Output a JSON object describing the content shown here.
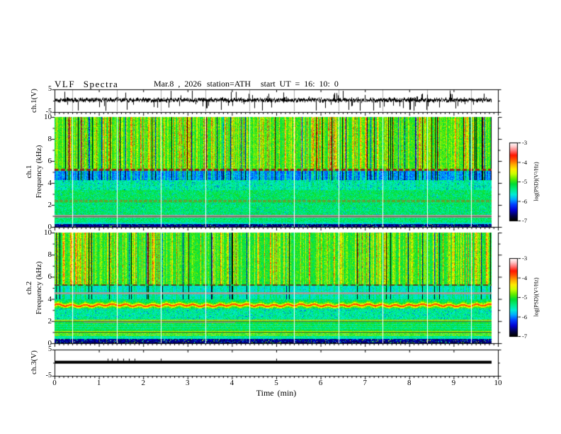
{
  "header": {
    "title": "VLF Spectra",
    "date": "Mar.8 , 2026",
    "station": "station=ATH",
    "start_ut": "start UT = 16: 10: 0"
  },
  "figure": {
    "xlabel": "Time (min)",
    "x_ticks": [
      0,
      1,
      2,
      3,
      4,
      5,
      6,
      7,
      8,
      9,
      10
    ],
    "x_range_min": [
      0,
      10
    ],
    "panels": [
      {
        "id": "ch1-waveform",
        "ylabel": "ch.1(V)",
        "y_ticks": [
          5,
          -5
        ],
        "y_range": [
          -5,
          5
        ],
        "type": "line"
      },
      {
        "id": "ch1-spectrogram",
        "channel": "ch.1",
        "ylabel": "Frequency (kHz)",
        "y_ticks": [
          10,
          8,
          6,
          4,
          2,
          0
        ],
        "y_range": [
          0,
          10
        ],
        "type": "heatmap"
      },
      {
        "id": "ch2-spectrogram",
        "channel": "ch.2",
        "ylabel": "Frequency (kHz)",
        "y_ticks": [
          10,
          8,
          6,
          4,
          2,
          0
        ],
        "y_range": [
          0,
          10
        ],
        "type": "heatmap"
      },
      {
        "id": "ch3-waveform",
        "ylabel": "ch.3(V)",
        "y_ticks": [
          5,
          -5
        ],
        "y_range": [
          -5,
          5
        ],
        "type": "line"
      }
    ],
    "colorbar": {
      "label": "log(PSD)(V²/Hz)",
      "ticks": [
        -3,
        -4,
        -5,
        -6,
        -7
      ],
      "range": [
        -7,
        -3
      ]
    }
  },
  "chart_data": [
    {
      "type": "line",
      "panel": "ch1-waveform",
      "ylabel": "ch.1(V)",
      "ylim": [
        -5,
        5
      ],
      "xlim": [
        0,
        10
      ],
      "xunit": "min",
      "duration_min": 9.85,
      "baseline_v": 0.3,
      "noise_envelope_v": 1.2,
      "spike_description": "dense broadband noise with frequent impulsive sferic spikes reaching ±5 V",
      "segment_gap_minutes": [
        0.4,
        1.4,
        2.4,
        3.4,
        4.4,
        5.4,
        6.4,
        7.4,
        8.4,
        9.4
      ]
    },
    {
      "type": "heatmap",
      "panel": "ch1-spectrogram",
      "ylabel": "ch.1 Frequency (kHz)",
      "ylim": [
        0,
        10
      ],
      "xlim": [
        0,
        10
      ],
      "duration_min": 9.85,
      "colorbar": {
        "label": "log(PSD)(V²/Hz)",
        "ticks": [
          -3,
          -4,
          -5,
          -6,
          -7
        ],
        "range": [
          -7,
          -3
        ]
      },
      "colormap": {
        "note": "rainbow: black(-7) > blue > cyan > green > yellow > orange > red > pink > white(-3)",
        "stops": [
          [
            0,
            0,
            0,
            0
          ],
          [
            0.06,
            0,
            0,
            80
          ],
          [
            0.13,
            0,
            0,
            210
          ],
          [
            0.2,
            0,
            60,
            255
          ],
          [
            0.27,
            0,
            170,
            255
          ],
          [
            0.33,
            0,
            235,
            215
          ],
          [
            0.4,
            0,
            235,
            130
          ],
          [
            0.47,
            0,
            220,
            50
          ],
          [
            0.53,
            90,
            235,
            0
          ],
          [
            0.6,
            205,
            255,
            0
          ],
          [
            0.66,
            255,
            235,
            0
          ],
          [
            0.72,
            255,
            170,
            0
          ],
          [
            0.78,
            255,
            85,
            0
          ],
          [
            0.84,
            255,
            20,
            0
          ],
          [
            0.9,
            255,
            120,
            120
          ],
          [
            0.95,
            255,
            200,
            200
          ],
          [
            1,
            255,
            255,
            255
          ]
        ]
      },
      "gap_minutes": [
        0.4,
        1.4,
        2.4,
        3.4,
        4.4,
        5.4,
        6.4,
        7.4,
        8.4,
        9.4
      ],
      "bands": [
        {
          "f": [
            5.3,
            10.0
          ],
          "v": -5.15,
          "fx": "streaks",
          "amp": 1.35,
          "note": "green base, dense yellow/orange/red vertical streaks, sparse black sferic columns"
        },
        {
          "f": [
            5.1,
            5.3
          ],
          "v": -5.0,
          "fx": "dashed",
          "rgb": [
            145,
            45,
            25
          ],
          "period": 9,
          "duty": 6,
          "note": "dark-red dashed horizontal line"
        },
        {
          "f": [
            4.25,
            5.1
          ],
          "v": -6.15,
          "fx": "streaks",
          "amp": 1.0,
          "note": "blue band with cyan vertical streaks"
        },
        {
          "f": [
            3.35,
            4.25
          ],
          "v": -5.55,
          "fx": "speckle",
          "amp": 0.3
        },
        {
          "f": [
            2.45,
            3.35
          ],
          "v": -5.25,
          "fx": "speckle"
        },
        {
          "f": [
            2.2,
            2.45
          ],
          "v": -5.25,
          "fx": "hlines",
          "rgb": [
            150,
            118,
            40
          ],
          "lines": [
            [
              2.34,
              2.42
            ],
            [
              2.23,
              2.3
            ]
          ],
          "period": 7,
          "duty": 5,
          "note": "olive dashed lines"
        },
        {
          "f": [
            1.05,
            2.2
          ],
          "v": -5.3,
          "fx": "speckle"
        },
        {
          "f": [
            0.82,
            1.05
          ],
          "fx": "gray",
          "rgb": [
            152,
            150,
            140
          ],
          "dark": [
            0.88,
            0.94
          ],
          "note": "gray instrumental band near 0.9 kHz"
        },
        {
          "f": [
            0.35,
            0.82
          ],
          "v": -5.35,
          "fx": "plain"
        },
        {
          "f": [
            0.22,
            0.35
          ],
          "v": -5.7,
          "fx": "plain"
        },
        {
          "f": [
            0.0,
            0.22
          ],
          "v": -6.85,
          "fx": "speckle-dark",
          "note": "near-black base band with bright speckles"
        }
      ]
    },
    {
      "type": "heatmap",
      "panel": "ch2-spectrogram",
      "ylabel": "ch.2 Frequency (kHz)",
      "ylim": [
        0,
        10
      ],
      "xlim": [
        0,
        10
      ],
      "duration_min": 9.85,
      "colorbar": {
        "label": "log(PSD)(V²/Hz)",
        "ticks": [
          -3,
          -4,
          -5,
          -6,
          -7
        ],
        "range": [
          -7,
          -3
        ]
      },
      "gap_minutes": [
        0.4,
        1.4,
        2.4,
        3.4,
        4.4,
        5.4,
        6.4,
        7.4,
        8.4,
        9.4
      ],
      "bands": [
        {
          "f": [
            5.35,
            10.0
          ],
          "v": -5.2,
          "fx": "streaks",
          "amp": 1.25,
          "note": "green base, yellow/red vertical streaks, black sferic columns"
        },
        {
          "f": [
            5.18,
            5.35
          ],
          "v": -5.2,
          "fx": "dashed",
          "rgb": [
            90,
            70,
            25
          ],
          "period": 11,
          "duty": 7
        },
        {
          "f": [
            4.62,
            5.18
          ],
          "v": -5.7,
          "fx": "streaks",
          "amp": 0.5
        },
        {
          "f": [
            4.42,
            4.62
          ],
          "fx": "gray",
          "rgb": [
            152,
            150,
            140
          ],
          "note": "gray band near 4.5 kHz"
        },
        {
          "f": [
            3.95,
            4.42
          ],
          "v": -5.65,
          "fx": "streaks",
          "amp": 0.5
        },
        {
          "f": [
            3.1,
            3.95
          ],
          "v": -5.3,
          "fx": "wavy",
          "f0": 3.42,
          "wamp": 0.08,
          "core": -3.85,
          "halo": -4.5,
          "note": "strong red wavy emission line ~3.4 kHz with yellow halo"
        },
        {
          "f": [
            2.15,
            3.1
          ],
          "v": -5.45,
          "fx": "speckle"
        },
        {
          "f": [
            2.0,
            2.15
          ],
          "v": -5.3,
          "fx": "hline-v",
          "lines": [
            [
              2.04,
              2.1
            ]
          ],
          "lv": -4.25,
          "note": "thin orange line ~2.07 kHz"
        },
        {
          "f": [
            1.75,
            2.0
          ],
          "v": -5.2,
          "fx": "olive",
          "rgb": [
            120,
            108,
            45
          ],
          "lines": [
            [
              1.93,
              1.99
            ],
            [
              1.82,
              1.87
            ]
          ],
          "gray": [
            1.87,
            1.93
          ],
          "grayCols": [
            40,
            255
          ],
          "grayRgb": [
            150,
            150,
            138
          ]
        },
        {
          "f": [
            1.28,
            1.75
          ],
          "v": -5.3,
          "fx": "striate",
          "samp": 0.25,
          "sfreq": 37
        },
        {
          "f": [
            1.05,
            1.28
          ],
          "v": -5.2,
          "fx": "plain"
        },
        {
          "f": [
            0.92,
            1.05
          ],
          "v": -4.6,
          "fx": "hline-dark",
          "dark": [
            0.92,
            0.98
          ],
          "rgb": [
            100,
            90,
            30
          ],
          "note": "yellow line ~1 kHz with dark edge"
        },
        {
          "f": [
            0.6,
            0.92
          ],
          "v": -5.0,
          "fx": "odash",
          "lines": [
            [
              0.68,
              0.76
            ]
          ],
          "lv": -4.3,
          "period": 17,
          "duty": 6,
          "samp": 0.3,
          "sfreq": 55
        },
        {
          "f": [
            0.35,
            0.6
          ],
          "v": -5.5,
          "fx": "plain"
        },
        {
          "f": [
            0.12,
            0.35
          ],
          "v": -6.8,
          "fx": "speckle-dark"
        },
        {
          "f": [
            0.0,
            0.12
          ],
          "v": -6.9,
          "fx": "speckle-dark"
        }
      ]
    },
    {
      "type": "line",
      "panel": "ch3-waveform",
      "ylabel": "ch.3(V)",
      "ylim": [
        -5,
        5
      ],
      "xlim": [
        0,
        10
      ],
      "duration_min": 9.85,
      "value_v": 0.2,
      "uptick_minutes": [
        1.2,
        1.3,
        1.42,
        1.55,
        1.67,
        1.8,
        2.4,
        5.0
      ],
      "description": "flat thick constant trace at about +0.2 V across the whole record"
    }
  ]
}
